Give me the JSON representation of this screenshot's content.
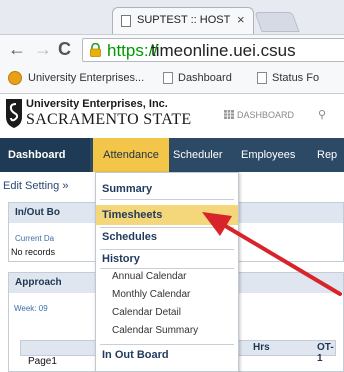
{
  "browser": {
    "tab_title": "SUPTEST :: HOST :: 4000 S",
    "tab_close": "×",
    "nav_back": "←",
    "nav_forward": "→",
    "nav_reload": "C",
    "url_scheme": "https://",
    "url_rest": "timeonline.uei.csus",
    "bookmarks": [
      {
        "label": "University Enterprises..."
      },
      {
        "label": "Dashboard"
      },
      {
        "label": "Status Fo"
      }
    ]
  },
  "site": {
    "org_line1": "University Enterprises, Inc.",
    "org_line2": "SACRAMENTO STATE",
    "dashboard_link": "DASHBOARD"
  },
  "mainnav": {
    "items": [
      {
        "label": "Dashboard"
      },
      {
        "label": "Attendance"
      },
      {
        "label": "Scheduler"
      },
      {
        "label": "Employees"
      },
      {
        "label": "Rep"
      }
    ]
  },
  "content": {
    "breadcrumb": "Edit Setting »",
    "panel1": {
      "heading": "In/Out Bo",
      "label": "Current Da",
      "no_records": "No records"
    },
    "panel2": {
      "heading": "Approach",
      "week": "Week: 09",
      "col_e": "E",
      "col_hrs": "Hrs",
      "col_ot": "OT-1",
      "row_page": "Page1"
    }
  },
  "dropdown": {
    "summary": "Summary",
    "timesheets": "Timesheets",
    "schedules": "Schedules",
    "history": "History",
    "annual_calendar": "Annual Calendar",
    "monthly_calendar": "Monthly Calendar",
    "calendar_detail": "Calendar Detail",
    "calendar_summary": "Calendar Summary",
    "in_out_board": "In Out Board"
  },
  "colors": {
    "nav_bg": "#2c4a66",
    "attendance_active": "#f3c64a",
    "timesheets_highlight": "#f3d77a",
    "arrow": "#d8232a"
  }
}
